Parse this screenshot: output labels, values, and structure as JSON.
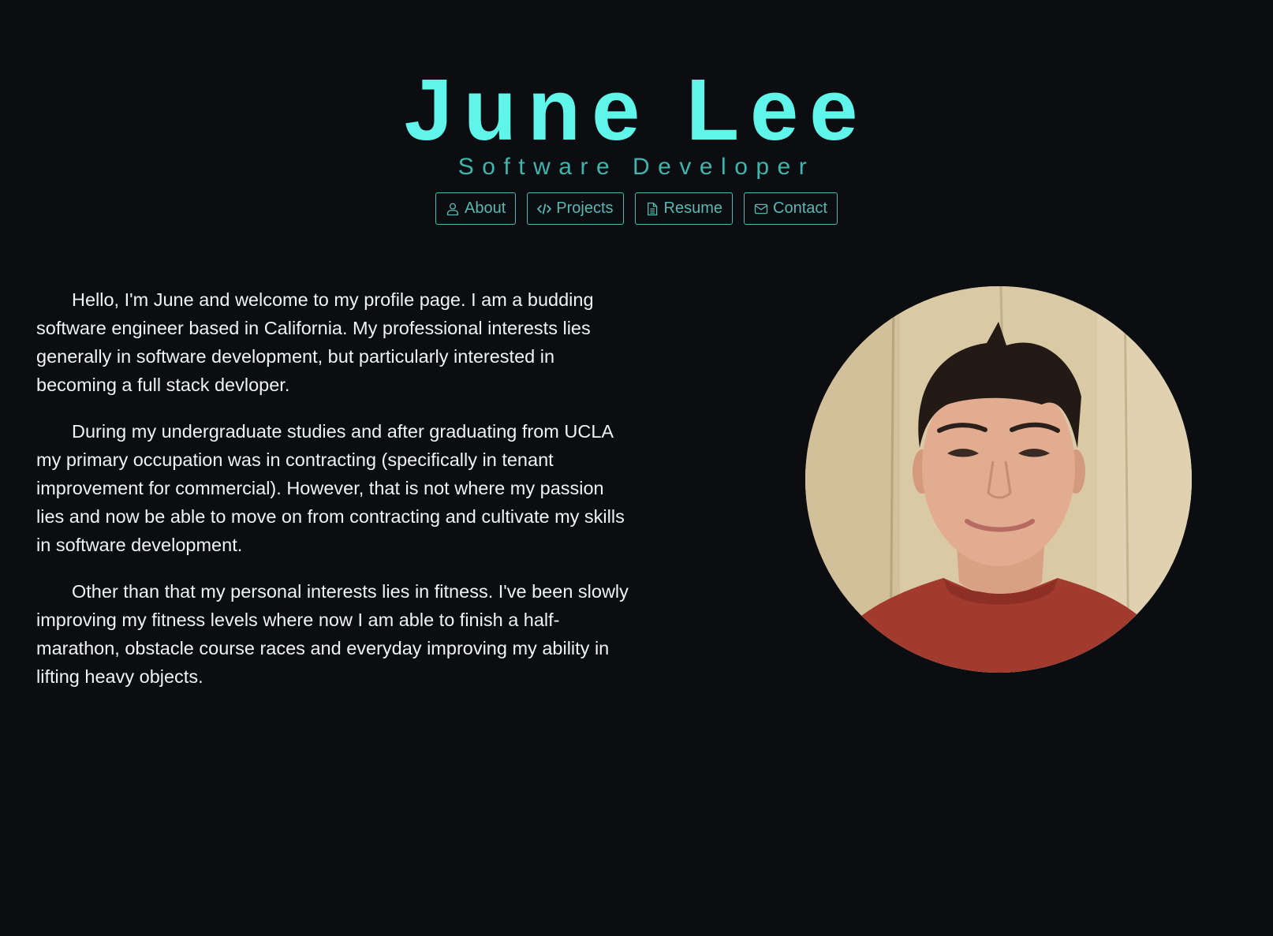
{
  "header": {
    "name": "June Lee",
    "role": "Software Developer"
  },
  "nav": {
    "items": [
      {
        "label": "About",
        "icon": "user-icon"
      },
      {
        "label": "Projects",
        "icon": "code-icon"
      },
      {
        "label": "Resume",
        "icon": "document-icon"
      },
      {
        "label": "Contact",
        "icon": "envelope-icon"
      }
    ]
  },
  "about": {
    "paragraphs": [
      "Hello, I'm June and welcome to my profile page. I am a budding software engineer based in California. My professional interests lies generally in software development, but particularly interested in becoming a full stack devloper.",
      "During my undergraduate studies and after graduating from UCLA my primary occupation was in contracting (specifically in tenant improvement for commercial). However, that is not where my passion lies and now be able to move on from contracting and cultivate my skills in software development.",
      "Other than that my personal interests lies in fitness. I've been slowly improving my fitness levels where now I am able to finish a half-marathon, obstacle course races and everyday improving my ability in lifting heavy objects."
    ]
  },
  "colors": {
    "background": "#0b0d11",
    "accent": "#5ff5ea",
    "accent_muted": "#3fb5ad",
    "text": "#f1f2f3"
  }
}
